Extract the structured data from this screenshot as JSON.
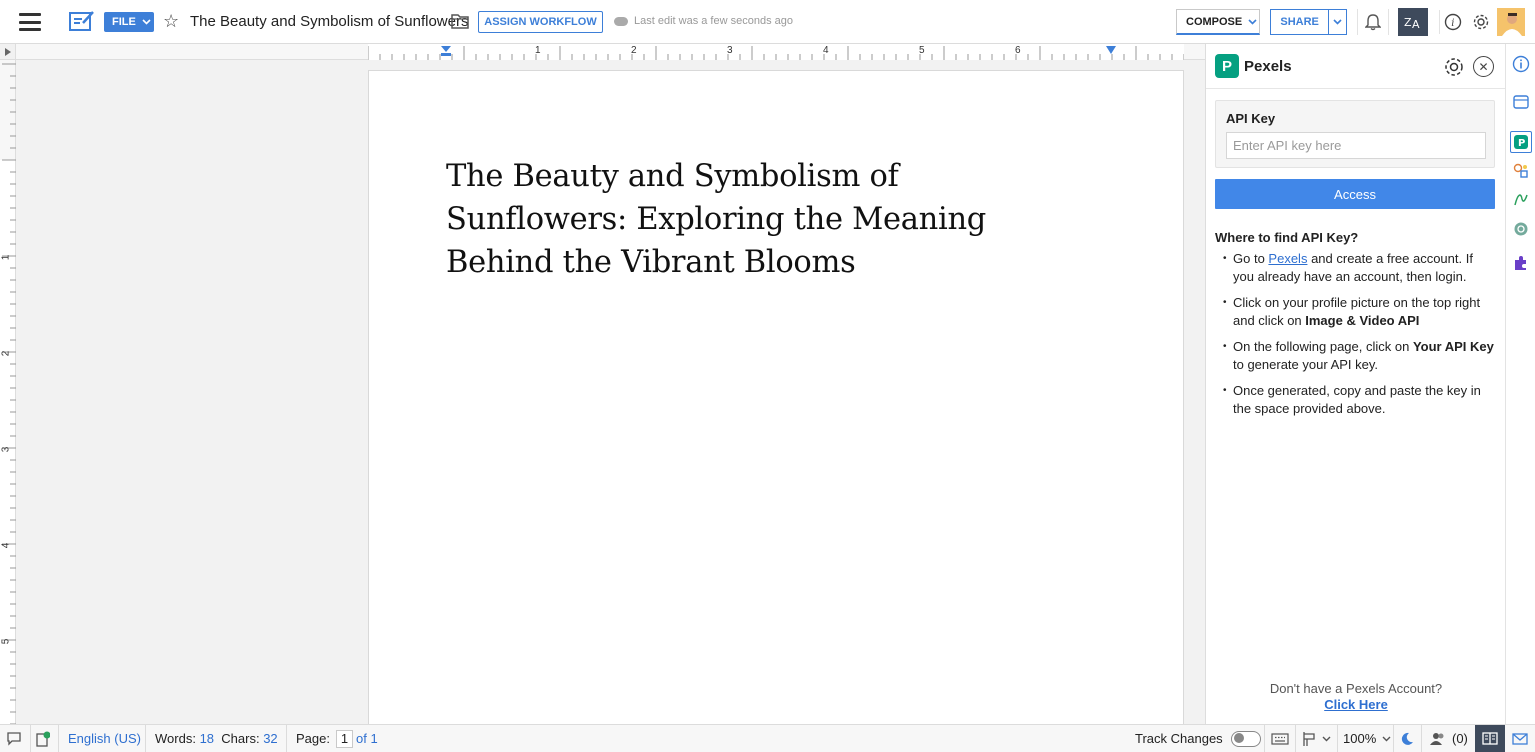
{
  "topbar": {
    "file_label": "FILE",
    "doc_title": "The Beauty and Symbolism of Sunflowers",
    "assign_workflow": "ASSIGN WORKFLOW",
    "last_edit": "Last edit was a few seconds ago",
    "compose": "COMPOSE",
    "share": "SHARE",
    "icons": [
      "hamburger-menu-icon",
      "writer-logo-icon",
      "star-icon",
      "folder-icon",
      "cloud-icon",
      "bell-icon",
      "translate-icon",
      "info-icon",
      "gear-icon",
      "avatar"
    ]
  },
  "ruler": {
    "h_labels": [
      "1",
      "2",
      "3",
      "4",
      "5",
      "6"
    ],
    "v_labels": [
      "1",
      "2",
      "3",
      "4",
      "5"
    ]
  },
  "document": {
    "heading": "The Beauty and Symbolism of Sunflowers: Exploring the Meaning Behind the Vibrant Blooms"
  },
  "panel": {
    "title": "Pexels",
    "api_key_label": "API Key",
    "api_key_placeholder": "Enter API key here",
    "api_key_value": "",
    "access_button": "Access",
    "where_heading": "Where to find API Key?",
    "step1_pre": "Go to ",
    "step1_link": "Pexels",
    "step1_post": " and create a free account. If you already have an account, then login.",
    "step2_pre": "Click on your profile picture on the top right and click on ",
    "step2_bold": "Image & Video API",
    "step3_pre": "On the following page, click on ",
    "step3_bold": "Your API Key",
    "step3_post": " to generate your API key.",
    "step4": "Once generated, copy and paste the key in the space provided above.",
    "no_account": "Don't have a Pexels Account?",
    "click_here": "Click Here"
  },
  "status": {
    "language": "English (US)",
    "words_label": "Words:",
    "words_value": "18",
    "chars_label": "Chars:",
    "chars_value": "32",
    "page_label": "Page:",
    "page_current": "1",
    "page_total": "of 1",
    "track_changes": "Track Changes",
    "zoom": "100%",
    "collaborators": "(0)"
  },
  "colors": {
    "accent": "#3d7fd8",
    "access_button": "#4187e8",
    "pexels_green": "#05a081",
    "dark_button": "#3e4a5c"
  }
}
